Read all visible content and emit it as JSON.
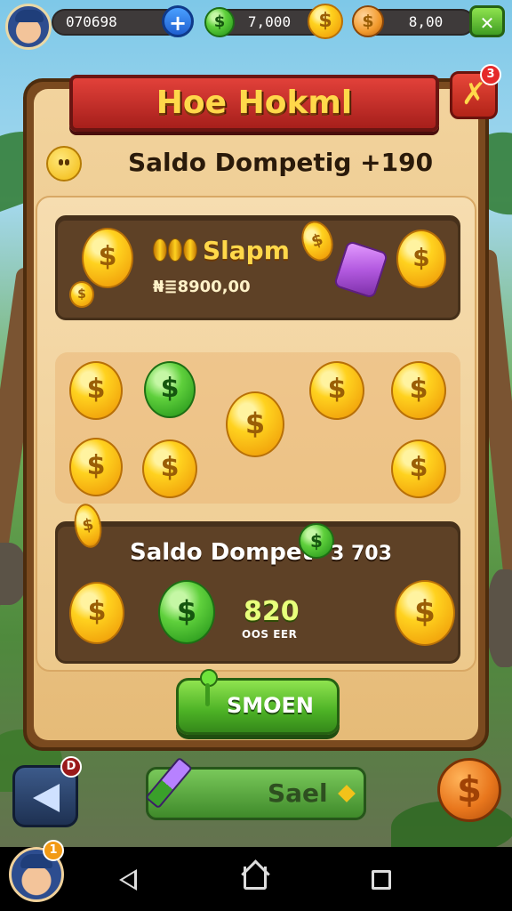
{
  "hud": {
    "left_value": "070698",
    "mid_value": "7,000",
    "right_value": "8,00",
    "add_label": "+",
    "confirm_label": "✕",
    "mid_coin_symbol": "$",
    "right_coin_symbol": "$"
  },
  "panel": {
    "title": "Hoe Hokml",
    "close_symbol": "✗",
    "close_badge": "3",
    "balance_text": "Saldo Dompetig +190"
  },
  "top_card": {
    "name": "Slapm",
    "amount": "₦≣8900,00",
    "coin_symbol": "$"
  },
  "coin_grid": {
    "symbol": "$"
  },
  "bottom_card": {
    "title": "Saldo Dompet",
    "value": "3 703",
    "big_number": "820",
    "caption": "OOS EER",
    "coin_symbol": "$"
  },
  "action_button": {
    "label": "SMOEN"
  },
  "footer": {
    "sell_label": "Sael",
    "back_badge": "D",
    "big_coin_symbol": "$",
    "avatar_badge": "1"
  },
  "colors": {
    "panel_wood": "#7a4a1f",
    "parchment": "#f2d39d",
    "title_red": "#c2302a",
    "title_gold": "#ffd84a",
    "button_green": "#4cb125",
    "coin_gold": "#ffd21f",
    "coin_green": "#5fd03c"
  }
}
